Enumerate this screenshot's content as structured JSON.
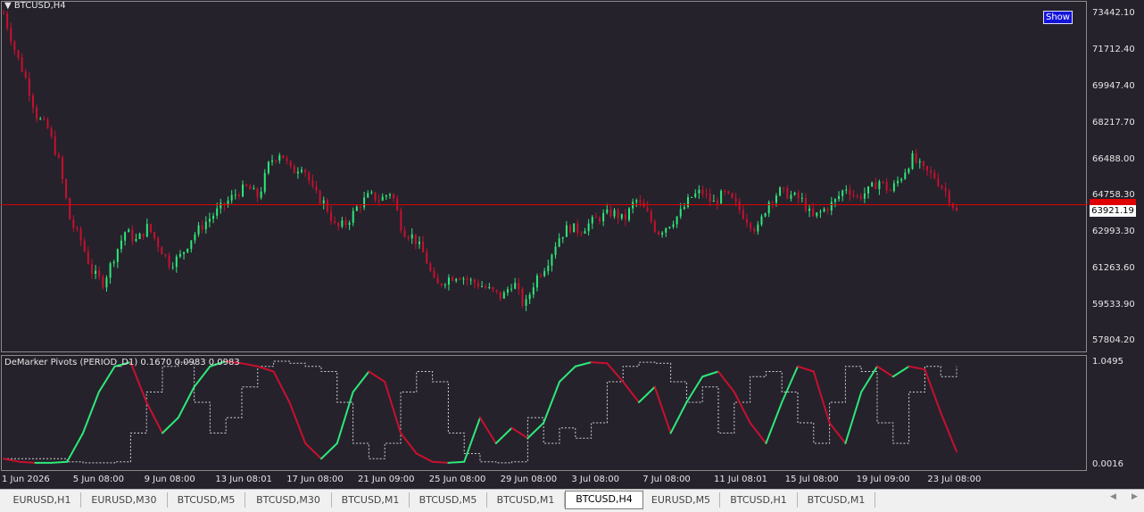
{
  "symbol_label": "BTCUSD,H4",
  "indicator_label": "DeMarker Pivots (PERIOD_D1) 0.1670 0.0983 0.0983",
  "show_button": "Show",
  "price_axis": [
    "73442.10",
    "71712.40",
    "69947.40",
    "68217.70",
    "66488.00",
    "64758.30",
    "62993.30",
    "61263.60",
    "59533.90",
    "57804.20"
  ],
  "current_price": "63921.19",
  "indicator_axis": {
    "top": "1.0495",
    "bottom": "0.0016"
  },
  "time_axis": [
    "1 Jun 2026",
    "5 Jun 08:00",
    "9 Jun 08:00",
    "13 Jun 08:01",
    "17 Jun 08:00",
    "21 Jun 09:00",
    "25 Jun 08:00",
    "29 Jun 08:00",
    "3 Jul 08:00",
    "7 Jul 08:00",
    "11 Jul 08:01",
    "15 Jul 08:00",
    "19 Jul 09:00",
    "23 Jul 08:00"
  ],
  "tabs": [
    {
      "label": "EURUSD,H1",
      "active": false
    },
    {
      "label": "EURUSD,M30",
      "active": false
    },
    {
      "label": "BTCUSD,M5",
      "active": false
    },
    {
      "label": "BTCUSD,M30",
      "active": false
    },
    {
      "label": "BTCUSD,M1",
      "active": false
    },
    {
      "label": "BTCUSD,M5",
      "active": false
    },
    {
      "label": "BTCUSD,M1",
      "active": false
    },
    {
      "label": "BTCUSD,H4",
      "active": true
    },
    {
      "label": "EURUSD,M5",
      "active": false
    },
    {
      "label": "BTCUSD,H1",
      "active": false
    },
    {
      "label": "BTCUSD,M1",
      "active": false
    }
  ],
  "colors": {
    "background": "#25222c",
    "bull": "#2ee878",
    "bear": "#c8102e",
    "price_line": "#e00000",
    "pivot": "#d0d0d0"
  },
  "chart_data": {
    "type": "candlestick",
    "price_path": [
      73442,
      71712,
      70300,
      68500,
      67900,
      66300,
      63500,
      62500,
      61000,
      60500,
      61800,
      63000,
      62500,
      63200,
      62300,
      61400,
      61800,
      62700,
      63300,
      63800,
      64300,
      64800,
      65100,
      64600,
      66300,
      66800,
      65800,
      66200,
      64800,
      64300,
      63100,
      63400,
      64200,
      64700,
      64500,
      64900,
      63000,
      62700,
      61800,
      60300,
      60700,
      60900,
      60600,
      60400,
      60100,
      59800,
      60600,
      59300,
      60700,
      61400,
      62600,
      63200,
      63000,
      63400,
      63700,
      63900,
      63500,
      64500,
      63900,
      62900,
      63300,
      63800,
      64600,
      64900,
      64300,
      64800,
      64300,
      63600,
      63000,
      64400,
      64900,
      64700,
      64500,
      63600,
      64000,
      64400,
      65100,
      64600,
      64900,
      65400,
      64900,
      65600,
      66500,
      65900,
      65600,
      64900,
      63900
    ],
    "demarker_series": [
      0.05,
      0.02,
      0.01,
      0.01,
      0.02,
      0.3,
      0.7,
      0.95,
      0.99,
      0.6,
      0.3,
      0.45,
      0.75,
      0.95,
      1.0,
      0.98,
      0.95,
      0.9,
      0.6,
      0.2,
      0.05,
      0.2,
      0.7,
      0.9,
      0.8,
      0.3,
      0.1,
      0.02,
      0.01,
      0.02,
      0.45,
      0.2,
      0.35,
      0.25,
      0.4,
      0.8,
      0.95,
      0.99,
      0.98,
      0.8,
      0.6,
      0.75,
      0.3,
      0.6,
      0.85,
      0.9,
      0.7,
      0.4,
      0.2,
      0.6,
      0.95,
      0.9,
      0.4,
      0.2,
      0.7,
      0.95,
      0.85,
      0.95,
      0.92,
      0.5,
      0.12
    ],
    "y_range": [
      57804.2,
      73442.1
    ]
  }
}
